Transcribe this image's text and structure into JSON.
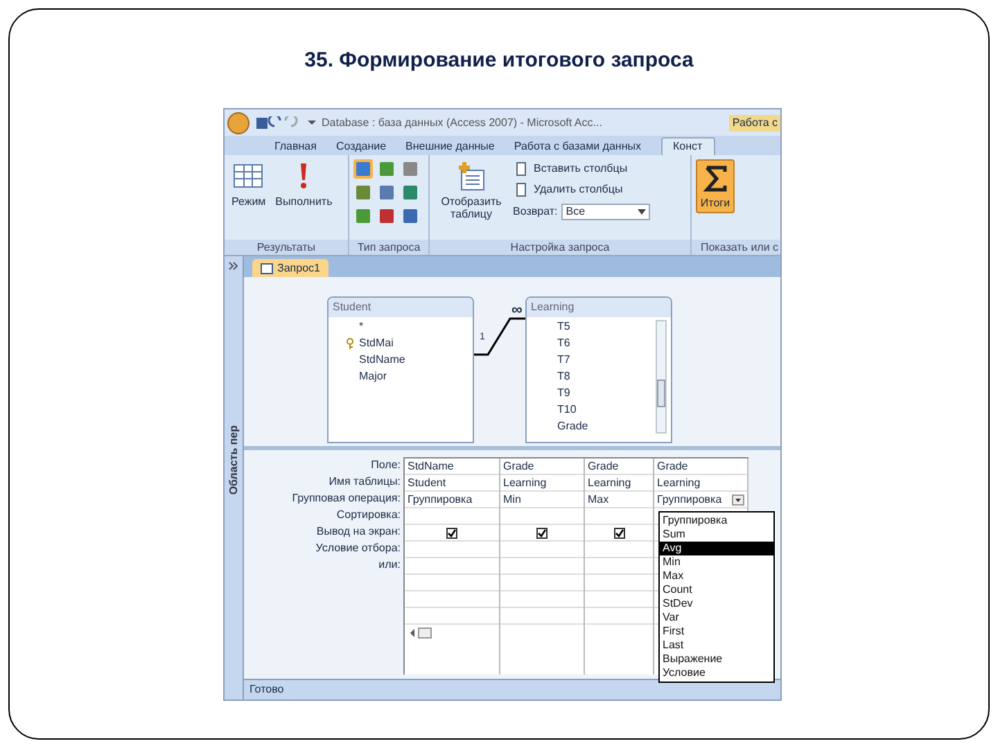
{
  "slide_title": "35. Формирование итогового запроса",
  "window": {
    "title": "Database : база данных (Access 2007) - Microsoft Acc...",
    "context_tab": "Работа с"
  },
  "ribbon_tabs": [
    {
      "label": "Главная",
      "selected": false
    },
    {
      "label": "Создание",
      "selected": false
    },
    {
      "label": "Внешние данные",
      "selected": false
    },
    {
      "label": "Работа с базами данных",
      "selected": false
    },
    {
      "label": "Конст",
      "selected": true
    }
  ],
  "ribbon_groups": [
    {
      "label": "Результаты",
      "items": [
        {
          "kind": "large",
          "label": "Режим",
          "selected": false
        },
        {
          "kind": "large",
          "label": "Выполнить",
          "selected": false
        }
      ]
    },
    {
      "label": "Тип запроса",
      "items": [
        {
          "kind": "icons"
        }
      ]
    },
    {
      "label": "Настройка запроса",
      "items": [
        {
          "kind": "large",
          "label": "Отобразить таблицу",
          "selected": false
        },
        {
          "kind": "small",
          "label": "Вставить столбцы"
        },
        {
          "kind": "small",
          "label": "Удалить столбцы"
        },
        {
          "kind": "select",
          "label": "Возврат:",
          "value": "Все"
        }
      ]
    },
    {
      "label": "Показать или с",
      "items": [
        {
          "kind": "large",
          "label": "Итоги",
          "selected": true
        }
      ]
    }
  ],
  "nav_pane": {
    "label": "Область пер"
  },
  "document_tab": {
    "label": "Запрос1"
  },
  "tables": [
    {
      "title": "Student",
      "fields": [
        {
          "name": "*",
          "key": false
        },
        {
          "name": "StdMai",
          "key": true
        },
        {
          "name": "StdName",
          "key": false
        },
        {
          "name": "Major",
          "key": false
        }
      ]
    },
    {
      "title": "Learning",
      "fields": [
        {
          "name": "T5",
          "key": false
        },
        {
          "name": "T6",
          "key": false
        },
        {
          "name": "T7",
          "key": false
        },
        {
          "name": "T8",
          "key": false
        },
        {
          "name": "T9",
          "key": false
        },
        {
          "name": "T10",
          "key": false
        },
        {
          "name": "Grade",
          "key": false
        }
      ]
    }
  ],
  "relationship": {
    "one": "1",
    "many": "∞"
  },
  "query_grid": {
    "row_labels": [
      "Поле:",
      "Имя таблицы:",
      "Групповая операция:",
      "Сортировка:",
      "Вывод на экран:",
      "Условие отбора:",
      "или:"
    ],
    "columns": [
      {
        "field": "StdName",
        "table": "Student",
        "total": "Группировка",
        "show": true
      },
      {
        "field": "Grade",
        "table": "Learning",
        "total": "Min",
        "show": true
      },
      {
        "field": "Grade",
        "table": "Learning",
        "total": "Max",
        "show": true
      },
      {
        "field": "Grade",
        "table": "Learning",
        "total": "Группировка"
      }
    ],
    "dropdown": [
      {
        "label": "Группировка",
        "selected": false
      },
      {
        "label": "Sum",
        "selected": false
      },
      {
        "label": "Avg",
        "selected": true
      },
      {
        "label": "Min",
        "selected": false
      },
      {
        "label": "Max",
        "selected": false
      },
      {
        "label": "Count",
        "selected": false
      },
      {
        "label": "StDev",
        "selected": false
      },
      {
        "label": "Var",
        "selected": false
      },
      {
        "label": "First",
        "selected": false
      },
      {
        "label": "Last",
        "selected": false
      },
      {
        "label": "Выражение",
        "selected": false
      },
      {
        "label": "Условие",
        "selected": false
      }
    ]
  },
  "status_bar": {
    "text": "Готово"
  }
}
